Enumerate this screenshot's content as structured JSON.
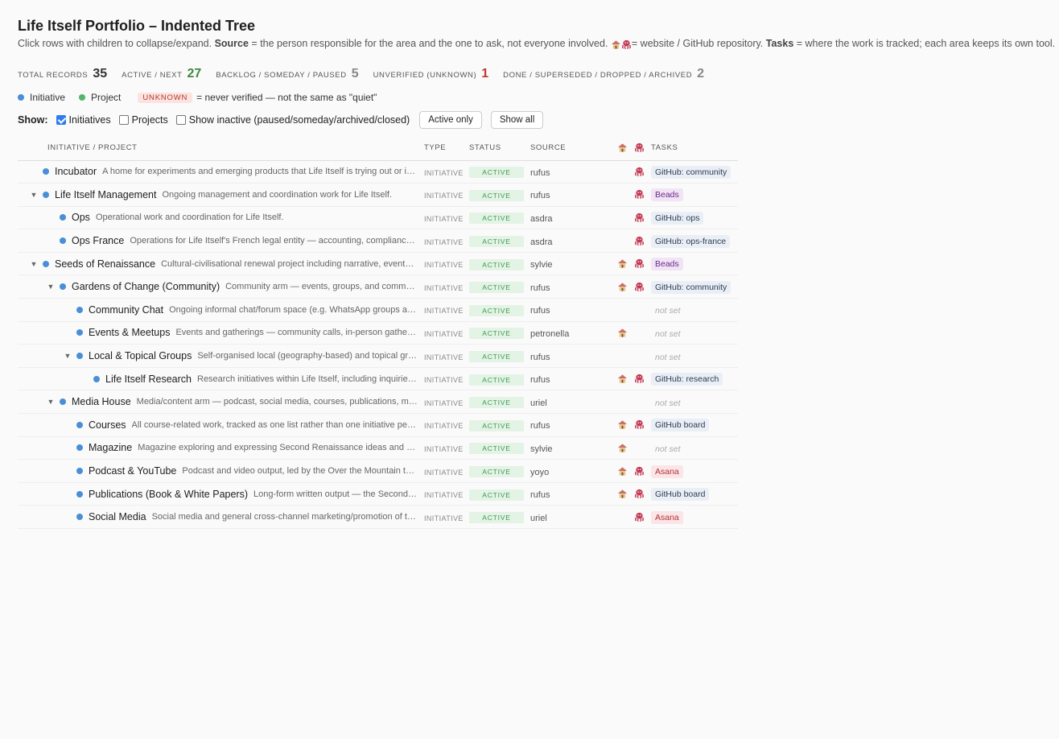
{
  "title": "Life Itself Portfolio – Indented Tree",
  "subtitle": {
    "part1": "Click rows with children to collapse/expand. ",
    "source_label": "Source",
    "part2": " = the person responsible for the area and the one to ask, not everyone involved. ",
    "part3": "= website / GitHub repository. ",
    "tasks_label": "Tasks",
    "part4": " = where the work is tracked; each area keeps its own tool."
  },
  "stats": [
    {
      "label": "TOTAL RECORDS",
      "value": "35"
    },
    {
      "label": "ACTIVE / NEXT",
      "value": "27"
    },
    {
      "label": "BACKLOG / SOMEDAY / PAUSED",
      "value": "5"
    },
    {
      "label": "UNVERIFIED (UNKNOWN)",
      "value": "1"
    },
    {
      "label": "DONE / SUPERSEDED / DROPPED / ARCHIVED",
      "value": "2"
    }
  ],
  "legend": {
    "initiative": "Initiative",
    "project": "Project",
    "unknown_pill": "UNKNOWN",
    "unknown_text": "= never verified — not the same as \"quiet\""
  },
  "show_bar": {
    "label": "Show:",
    "initiatives": "Initiatives",
    "projects": "Projects",
    "inactive": "Show inactive (paused/someday/archived/closed)",
    "active_only": "Active only",
    "show_all": "Show all"
  },
  "columns": {
    "name": "INITIATIVE / PROJECT",
    "type": "TYPE",
    "status": "STATUS",
    "source": "SOURCE",
    "tasks": "TASKS"
  },
  "rows": [
    {
      "name": "Incubator",
      "desc": "A home for experiments and emerging products that Life Itself is trying out or incubating.",
      "type": "INITIATIVE",
      "status": "ACTIVE",
      "source": "rufus",
      "web": false,
      "gh": true,
      "tasks": "GitHub: community",
      "tasks_kind": "gh",
      "depth": 0,
      "caret": false
    },
    {
      "name": "Life Itself Management",
      "desc": "Ongoing management and coordination work for Life Itself.",
      "type": "INITIATIVE",
      "status": "ACTIVE",
      "source": "rufus",
      "web": false,
      "gh": true,
      "tasks": "Beads",
      "tasks_kind": "beads",
      "depth": 0,
      "caret": true
    },
    {
      "name": "Ops",
      "desc": "Operational work and coordination for Life Itself.",
      "type": "INITIATIVE",
      "status": "ACTIVE",
      "source": "asdra",
      "web": false,
      "gh": true,
      "tasks": "GitHub: ops",
      "tasks_kind": "gh",
      "depth": 1,
      "caret": false
    },
    {
      "name": "Ops France",
      "desc": "Operations for Life Itself's French legal entity — accounting, compliance and administration.",
      "type": "INITIATIVE",
      "status": "ACTIVE",
      "source": "asdra",
      "web": false,
      "gh": true,
      "tasks": "GitHub: ops-france",
      "tasks_kind": "gh",
      "depth": 1,
      "caret": false
    },
    {
      "name": "Seeds of Renaissance",
      "desc": "Cultural-civilisational renewal project including narrative, events and community.",
      "type": "INITIATIVE",
      "status": "ACTIVE",
      "source": "sylvie",
      "web": true,
      "gh": true,
      "tasks": "Beads",
      "tasks_kind": "beads",
      "depth": 0,
      "caret": true
    },
    {
      "name": "Gardens of Change (Community)",
      "desc": "Community arm — events, groups, and community spaces.",
      "type": "INITIATIVE",
      "status": "ACTIVE",
      "source": "rufus",
      "web": true,
      "gh": true,
      "tasks": "GitHub: community",
      "tasks_kind": "gh",
      "depth": 1,
      "caret": true
    },
    {
      "name": "Community Chat",
      "desc": "Ongoing informal chat/forum space (e.g. WhatsApp groups and forums).",
      "type": "INITIATIVE",
      "status": "ACTIVE",
      "source": "rufus",
      "web": false,
      "gh": false,
      "tasks": "not set",
      "tasks_kind": "none",
      "depth": 2,
      "caret": false
    },
    {
      "name": "Events & Meetups",
      "desc": "Events and gatherings — community calls, in-person gatherings and meetups.",
      "type": "INITIATIVE",
      "status": "ACTIVE",
      "source": "petronella",
      "web": true,
      "gh": false,
      "tasks": "not set",
      "tasks_kind": "none",
      "depth": 2,
      "caret": false
    },
    {
      "name": "Local & Topical Groups",
      "desc": "Self-organised local (geography-based) and topical groups.",
      "type": "INITIATIVE",
      "status": "ACTIVE",
      "source": "rufus",
      "web": false,
      "gh": false,
      "tasks": "not set",
      "tasks_kind": "none",
      "depth": 2,
      "caret": true
    },
    {
      "name": "Life Itself Research",
      "desc": "Research initiatives within Life Itself, including inquiries and studies.",
      "type": "INITIATIVE",
      "status": "ACTIVE",
      "source": "rufus",
      "web": true,
      "gh": true,
      "tasks": "GitHub: research",
      "tasks_kind": "gh",
      "depth": 3,
      "caret": false
    },
    {
      "name": "Media House",
      "desc": "Media/content arm — podcast, social media, courses, publications, magazine.",
      "type": "INITIATIVE",
      "status": "ACTIVE",
      "source": "uriel",
      "web": false,
      "gh": false,
      "tasks": "not set",
      "tasks_kind": "none",
      "depth": 1,
      "caret": true
    },
    {
      "name": "Courses",
      "desc": "All course-related work, tracked as one list rather than one initiative per course.",
      "type": "INITIATIVE",
      "status": "ACTIVE",
      "source": "rufus",
      "web": true,
      "gh": true,
      "tasks": "GitHub board",
      "tasks_kind": "gh",
      "depth": 2,
      "caret": false
    },
    {
      "name": "Magazine",
      "desc": "Magazine exploring and expressing Second Renaissance ideas and culture.",
      "type": "INITIATIVE",
      "status": "ACTIVE",
      "source": "sylvie",
      "web": true,
      "gh": false,
      "tasks": "not set",
      "tasks_kind": "none",
      "depth": 2,
      "caret": false
    },
    {
      "name": "Podcast & YouTube",
      "desc": "Podcast and video output, led by the Over the Mountain team.",
      "type": "INITIATIVE",
      "status": "ACTIVE",
      "source": "yoyo",
      "web": true,
      "gh": true,
      "tasks": "Asana",
      "tasks_kind": "asana",
      "depth": 2,
      "caret": false
    },
    {
      "name": "Publications (Book & White Papers)",
      "desc": "Long-form written output — the Second Renaissance book and white papers.",
      "type": "INITIATIVE",
      "status": "ACTIVE",
      "source": "rufus",
      "web": true,
      "gh": true,
      "tasks": "GitHub board",
      "tasks_kind": "gh",
      "depth": 2,
      "caret": false
    },
    {
      "name": "Social Media",
      "desc": "Social media and general cross-channel marketing/promotion of the work.",
      "type": "INITIATIVE",
      "status": "ACTIVE",
      "source": "uriel",
      "web": false,
      "gh": true,
      "tasks": "Asana",
      "tasks_kind": "asana",
      "depth": 2,
      "caret": false
    }
  ],
  "icons": {
    "website": "house-icon",
    "repo": "octopus-icon",
    "expand": "caret-down-icon"
  },
  "colors": {
    "initiative": "#4a8fd6",
    "project": "#55b56a",
    "active": "#3d8a3d",
    "unknown": "#c0392b"
  }
}
